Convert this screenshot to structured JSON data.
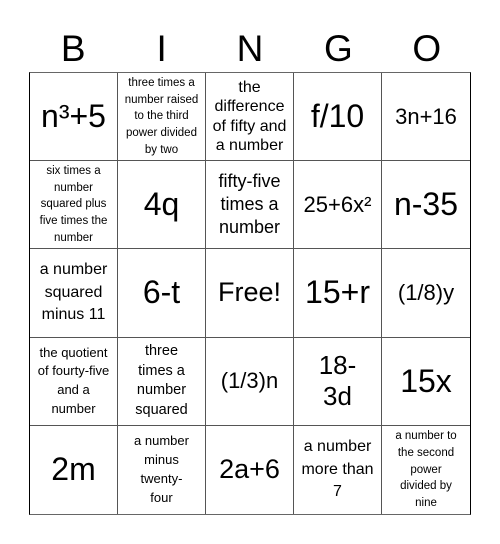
{
  "header": {
    "letters": [
      "B",
      "I",
      "N",
      "G",
      "O"
    ]
  },
  "cells": [
    {
      "text": "n³+5",
      "size": "xl"
    },
    {
      "text": "three times a number raised to the third power divided by two",
      "size": "xs"
    },
    {
      "text": "the difference of fifty and a number",
      "size": "ms"
    },
    {
      "text": "f/10",
      "size": "xl"
    },
    {
      "text": "3n+16",
      "size": "m"
    },
    {
      "text": "six times a number squared plus five times the number",
      "size": "xs"
    },
    {
      "text": "4q",
      "size": "xl"
    },
    {
      "text": "fifty-five times a number",
      "size": "m-wrap"
    },
    {
      "text": "25+6x²",
      "size": "m"
    },
    {
      "text": "n-35",
      "size": "xl"
    },
    {
      "text": "a number squared minus 11",
      "size": "ms"
    },
    {
      "text": "6-t",
      "size": "xl"
    },
    {
      "text": "Free!",
      "size": "l"
    },
    {
      "text": "15+r",
      "size": "xl"
    },
    {
      "text": "(1/8)y",
      "size": "m"
    },
    {
      "text": "the quotient of fourty-five and a number",
      "size": "s"
    },
    {
      "text": "three times a number squared",
      "size": "ms"
    },
    {
      "text": "(1/3)n",
      "size": "m"
    },
    {
      "text": "18-3d",
      "size": "l"
    },
    {
      "text": "15x",
      "size": "xl"
    },
    {
      "text": "2m",
      "size": "xl"
    },
    {
      "text": "a number minus twenty-four",
      "size": "s"
    },
    {
      "text": "2a+6",
      "size": "l"
    },
    {
      "text": "a number more than 7",
      "size": "ms"
    },
    {
      "text": "a number to the second power divided by nine",
      "size": "xs"
    }
  ]
}
